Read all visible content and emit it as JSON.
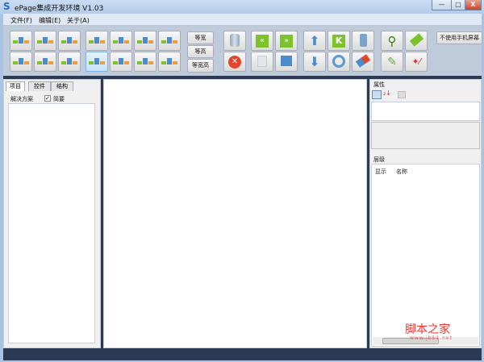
{
  "window": {
    "title": "ePage集成开发环境 V1.03",
    "minimize": "—",
    "maximize": "□",
    "close": "X"
  },
  "menu": [
    "文件(F)",
    "编辑(E)",
    "关于(A)"
  ],
  "toolbar": {
    "layout_buttons": [
      "align-left-icon",
      "align-center-icon",
      "align-right-icon",
      "space-vertical-icon",
      "space-vertical-2-icon",
      "space-vertical-3-icon",
      "space-vertical-4-icon",
      "align-top-icon",
      "align-middle-icon",
      "align-bottom-icon",
      "space-horizontal-icon",
      "space-horizontal-2-icon",
      "space-horizontal-3-icon",
      "space-horizontal-4-icon"
    ],
    "size_buttons": [
      "等宽",
      "等高",
      "等宽高"
    ],
    "no_phone_screen": "不使用手机屏幕"
  },
  "left_panel": {
    "tabs": [
      "项目",
      "控件",
      "结构"
    ],
    "solution_label": "解决方案",
    "summary_label": "简要",
    "summary_checked": true
  },
  "right_panel": {
    "properties_title": "属性",
    "layers_title": "层级",
    "columns": [
      "显示",
      "名称"
    ]
  },
  "watermark": {
    "text": "脚本之家",
    "url": "www.jb51.net"
  },
  "colors": {
    "dark": "#2b3a55",
    "green": "#7cc22a",
    "blue": "#4a8ccc",
    "red": "#e0452e"
  }
}
